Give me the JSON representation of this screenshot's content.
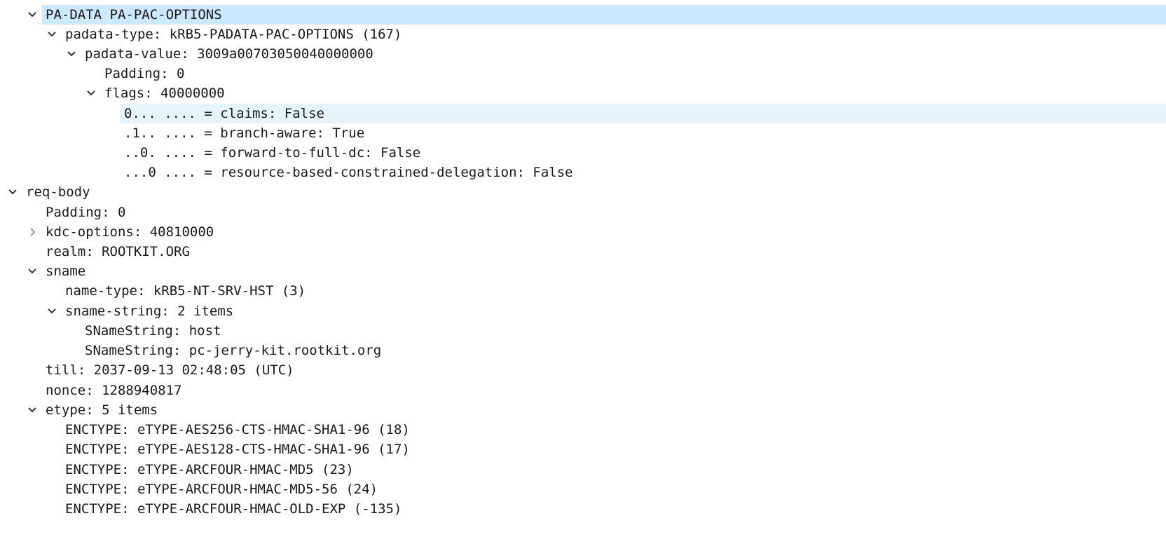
{
  "rows": [
    {
      "text": "PA-DATA PA-PAC-OPTIONS",
      "arrow": "down"
    },
    {
      "text": "padata-type: kRB5-PADATA-PAC-OPTIONS (167)",
      "arrow": "down"
    },
    {
      "text": "padata-value: 3009a00703050040000000",
      "arrow": "down"
    },
    {
      "text": "Padding: 0",
      "arrow": "none"
    },
    {
      "text": "flags: 40000000",
      "arrow": "down"
    },
    {
      "text": "0... .... = claims: False",
      "arrow": "none"
    },
    {
      "text": ".1.. .... = branch-aware: True",
      "arrow": "none"
    },
    {
      "text": "..0. .... = forward-to-full-dc: False",
      "arrow": "none"
    },
    {
      "text": "...0 .... = resource-based-constrained-delegation: False",
      "arrow": "none"
    },
    {
      "text": "req-body",
      "arrow": "down"
    },
    {
      "text": "Padding: 0",
      "arrow": "none"
    },
    {
      "text": "kdc-options: 40810000",
      "arrow": "right"
    },
    {
      "text": "realm: ROOTKIT.ORG",
      "arrow": "none"
    },
    {
      "text": "sname",
      "arrow": "down"
    },
    {
      "text": "name-type: kRB5-NT-SRV-HST (3)",
      "arrow": "none"
    },
    {
      "text": "sname-string: 2 items",
      "arrow": "down"
    },
    {
      "text": "SNameString: host",
      "arrow": "none"
    },
    {
      "text": "SNameString: pc-jerry-kit.rootkit.org",
      "arrow": "none"
    },
    {
      "text": "till: 2037-09-13 02:48:05 (UTC)",
      "arrow": "none"
    },
    {
      "text": "nonce: 1288940817",
      "arrow": "none"
    },
    {
      "text": "etype: 5 items",
      "arrow": "down"
    },
    {
      "text": "ENCTYPE: eTYPE-AES256-CTS-HMAC-SHA1-96 (18)",
      "arrow": "none"
    },
    {
      "text": "ENCTYPE: eTYPE-AES128-CTS-HMAC-SHA1-96 (17)",
      "arrow": "none"
    },
    {
      "text": "ENCTYPE: eTYPE-ARCFOUR-HMAC-MD5 (23)",
      "arrow": "none"
    },
    {
      "text": "ENCTYPE: eTYPE-ARCFOUR-HMAC-MD5-56 (24)",
      "arrow": "none"
    },
    {
      "text": "ENCTYPE: eTYPE-ARCFOUR-HMAC-OLD-EXP (-135)",
      "arrow": "none"
    }
  ]
}
